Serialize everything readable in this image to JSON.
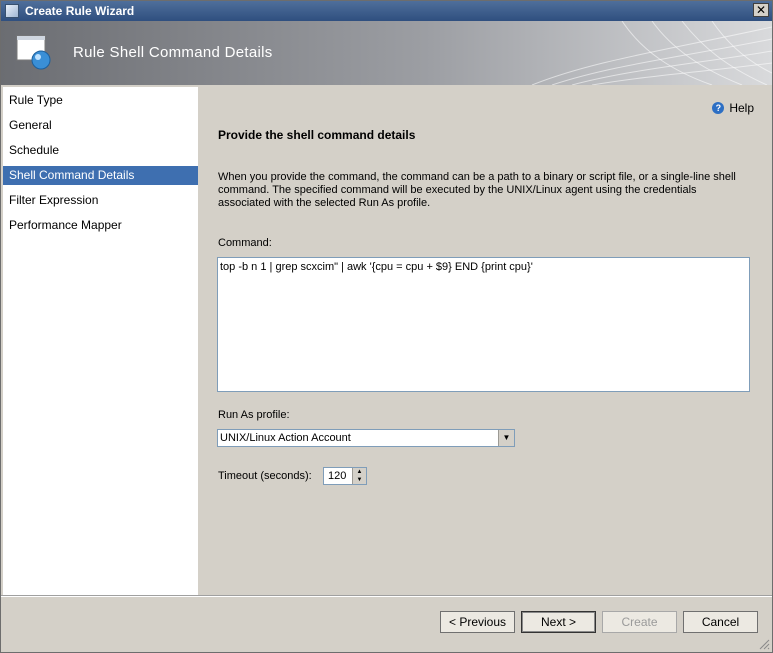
{
  "window": {
    "title": "Create Rule Wizard",
    "close_glyph": "✕"
  },
  "banner": {
    "title": "Rule Shell Command Details",
    "icon": "wizard-page-icon"
  },
  "nav": {
    "items": [
      {
        "label": "Rule Type"
      },
      {
        "label": "General"
      },
      {
        "label": "Schedule"
      },
      {
        "label": "Shell Command Details"
      },
      {
        "label": "Filter Expression"
      },
      {
        "label": "Performance Mapper"
      }
    ],
    "selected_index": 3,
    "selected_color": "#3e6fb0"
  },
  "page": {
    "help_label": "Help",
    "heading": "Provide the shell command details",
    "description": "When you provide the command, the command can be a path to a binary or script file, or a single-line shell command. The specified command will be executed by the UNIX/Linux agent using the credentials associated with the selected Run As profile.",
    "command_label": "Command:",
    "command_value": "top -b n 1 | grep scxcim\" | awk '{cpu = cpu + $9} END {print cpu}'",
    "runas_label": "Run As profile:",
    "runas_value": "UNIX/Linux Action Account",
    "timeout_label": "Timeout (seconds):",
    "timeout_value": "120"
  },
  "buttons": {
    "previous": "< Previous",
    "next": "Next >",
    "create": "Create",
    "cancel": "Cancel"
  }
}
